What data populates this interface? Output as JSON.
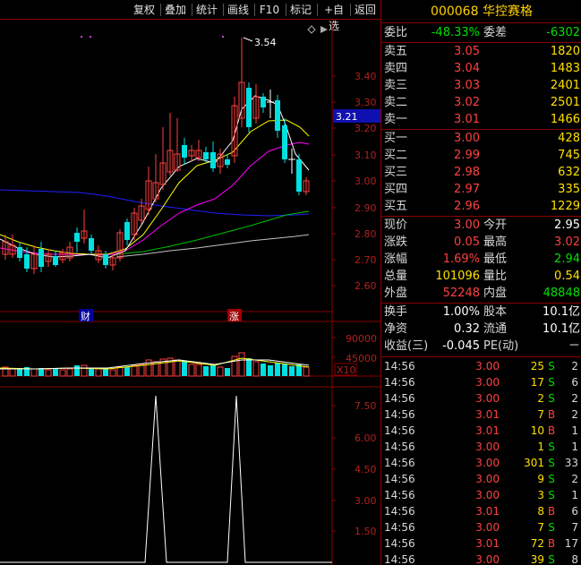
{
  "toolbar": {
    "buttons": [
      "复权",
      "叠加",
      "统计",
      "画线",
      "F10",
      "标记",
      "+自选",
      "返回"
    ]
  },
  "chart": {
    "price_ticks": [
      "3.40",
      "3.30",
      "3.20",
      "3.10",
      "3.00",
      "2.90",
      "2.80",
      "2.70",
      "2.60"
    ],
    "current_price_tag": "3.21",
    "high_marker": "3.54",
    "event_marker_1": "财",
    "event_marker_2": "涨",
    "volume_ticks": [
      "90000",
      "45000"
    ],
    "volume_unit": "X10",
    "indicator_ticks": [
      "7.50",
      "6.00",
      "4.50",
      "3.00",
      "1.50"
    ]
  },
  "stock": {
    "code": "000068",
    "name": "华控赛格"
  },
  "orderbook": {
    "wb_label": "委比",
    "wb_value": "-48.33%",
    "wc_label": "委差",
    "wc_value": "-6302",
    "asks": [
      {
        "label": "卖五",
        "price": "3.05",
        "vol": "1820"
      },
      {
        "label": "卖四",
        "price": "3.04",
        "vol": "1483"
      },
      {
        "label": "卖三",
        "price": "3.03",
        "vol": "2401"
      },
      {
        "label": "卖二",
        "price": "3.02",
        "vol": "2501"
      },
      {
        "label": "卖一",
        "price": "3.01",
        "vol": "1466"
      }
    ],
    "bids": [
      {
        "label": "买一",
        "price": "3.00",
        "vol": "428"
      },
      {
        "label": "买二",
        "price": "2.99",
        "vol": "745"
      },
      {
        "label": "买三",
        "price": "2.98",
        "vol": "632"
      },
      {
        "label": "买四",
        "price": "2.97",
        "vol": "335"
      },
      {
        "label": "买五",
        "price": "2.96",
        "vol": "1229"
      }
    ]
  },
  "quote": {
    "rows": [
      {
        "l1": "现价",
        "v1": "3.00",
        "l2": "今开",
        "v2": "2.95"
      },
      {
        "l1": "涨跌",
        "v1": "0.05",
        "l2": "最高",
        "v2": "3.02"
      },
      {
        "l1": "涨幅",
        "v1": "1.69%",
        "l2": "最低",
        "v2": "2.94"
      },
      {
        "l1": "总量",
        "v1": "101096",
        "l2": "量比",
        "v2": "0.54"
      },
      {
        "l1": "外盘",
        "v1": "52248",
        "l2": "内盘",
        "v2": "48848"
      }
    ]
  },
  "fundamentals": {
    "rows": [
      {
        "l1": "换手",
        "v1": "1.00%",
        "l2": "股本",
        "v2": "10.1亿"
      },
      {
        "l1": "净资",
        "v1": "0.32",
        "l2": "流通",
        "v2": "10.1亿"
      },
      {
        "l1": "收益(三)",
        "v1": "-0.045",
        "l2": "PE(动)",
        "v2": "－"
      }
    ]
  },
  "ticks": [
    {
      "time": "14:56",
      "price": "3.00",
      "qty": "25",
      "side": "S",
      "n": "2"
    },
    {
      "time": "14:56",
      "price": "3.00",
      "qty": "17",
      "side": "S",
      "n": "6"
    },
    {
      "time": "14:56",
      "price": "3.00",
      "qty": "2",
      "side": "S",
      "n": "2"
    },
    {
      "time": "14:56",
      "price": "3.01",
      "qty": "7",
      "side": "B",
      "n": "2"
    },
    {
      "time": "14:56",
      "price": "3.01",
      "qty": "10",
      "side": "B",
      "n": "1"
    },
    {
      "time": "14:56",
      "price": "3.00",
      "qty": "1",
      "side": "S",
      "n": "1"
    },
    {
      "time": "14:56",
      "price": "3.00",
      "qty": "301",
      "side": "S",
      "n": "33"
    },
    {
      "time": "14:56",
      "price": "3.00",
      "qty": "9",
      "side": "S",
      "n": "2"
    },
    {
      "time": "14:56",
      "price": "3.00",
      "qty": "3",
      "side": "S",
      "n": "1"
    },
    {
      "time": "14:56",
      "price": "3.01",
      "qty": "8",
      "side": "B",
      "n": "6"
    },
    {
      "time": "14:56",
      "price": "3.00",
      "qty": "7",
      "side": "S",
      "n": "7"
    },
    {
      "time": "14:56",
      "price": "3.01",
      "qty": "72",
      "side": "B",
      "n": "17"
    },
    {
      "time": "14:56",
      "price": "3.00",
      "qty": "39",
      "side": "S",
      "n": "8"
    }
  ],
  "colors": {
    "up": "#ff4040",
    "down": "#00e0e0",
    "grid": "#8b0000",
    "ma5": "#ffffff",
    "ma10": "#ffff00",
    "ma20": "#ff00ff",
    "ma60": "#00c000",
    "ma120": "#c0c0c0",
    "ma250": "#2020ff"
  }
}
